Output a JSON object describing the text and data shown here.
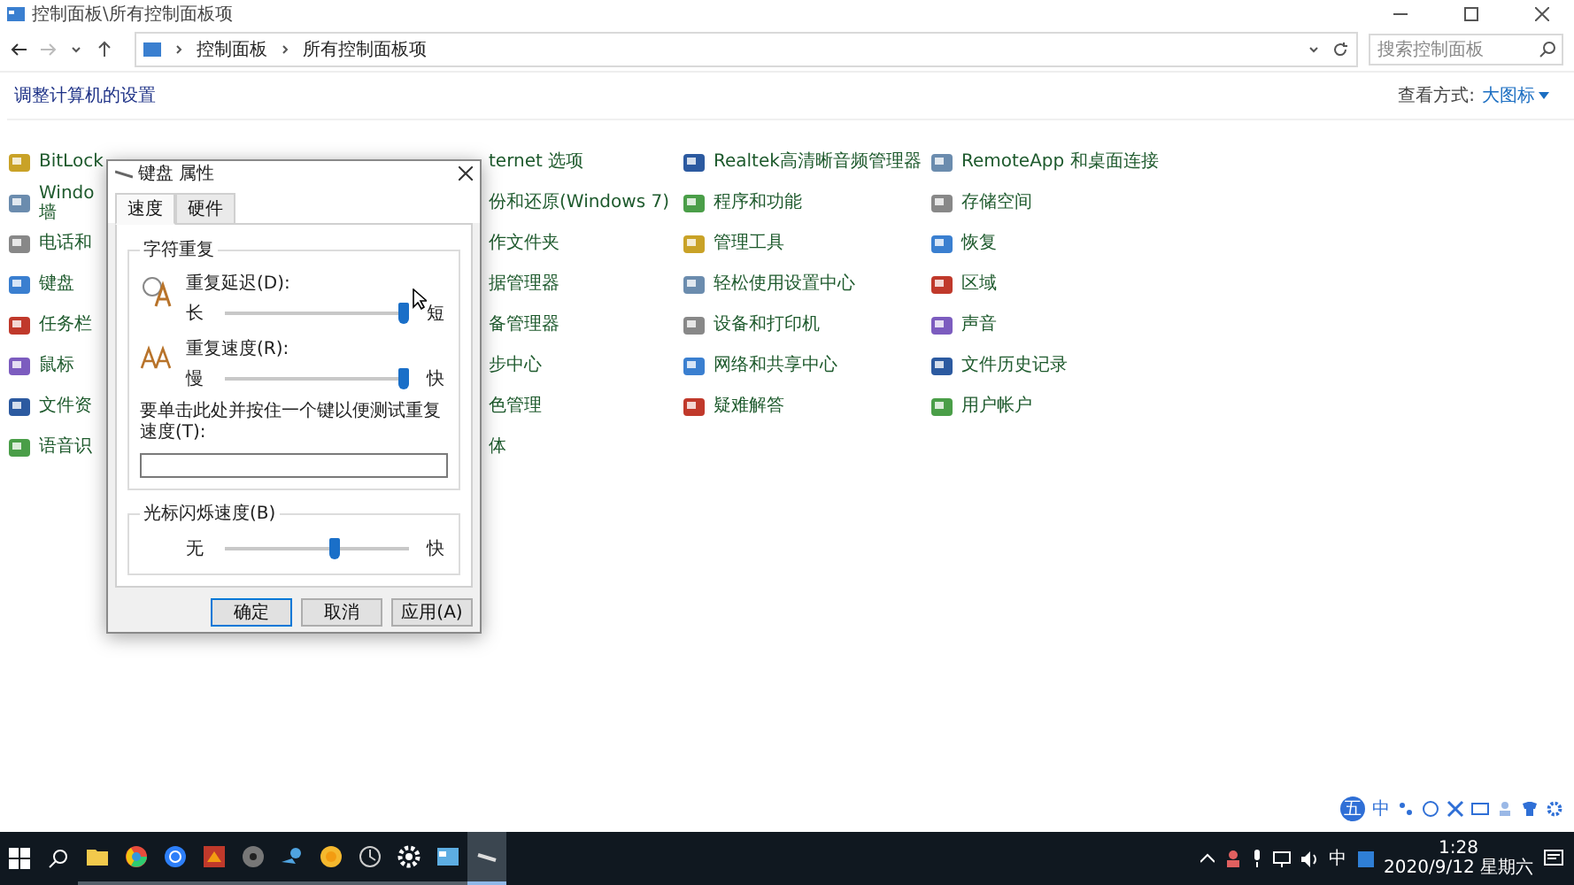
{
  "window": {
    "title": "控制面板\\所有控制面板项"
  },
  "address_bar": {
    "breadcrumb": [
      "控制面板",
      "所有控制面板项"
    ]
  },
  "search": {
    "placeholder": "搜索控制面板"
  },
  "heading": "调整计算机的设置",
  "view_by": {
    "label": "查看方式:",
    "value": "大图标"
  },
  "rows": [
    [
      "BitLock",
      "ternet 选项",
      "Realtek高清晰音频管理器",
      "RemoteApp 和桌面连接"
    ],
    [
      "Windo\n墙",
      "份和还原(Windows 7)",
      "程序和功能",
      "存储空间"
    ],
    [
      "电话和",
      "作文件夹",
      "管理工具",
      "恢复"
    ],
    [
      "键盘",
      "据管理器",
      "轻松使用设置中心",
      "区域"
    ],
    [
      "任务栏",
      "备管理器",
      "设备和打印机",
      "声音"
    ],
    [
      "鼠标",
      "步中心",
      "网络和共享中心",
      "文件历史记录"
    ],
    [
      "文件资",
      "色管理",
      "疑难解答",
      "用户帐户"
    ],
    [
      "语音识",
      "体"
    ]
  ],
  "dialog": {
    "title": "键盘 属性",
    "tabs": [
      {
        "label": "速度",
        "selected": true
      },
      {
        "label": "硬件",
        "selected": false
      }
    ],
    "groups": [
      {
        "title": "字符重复",
        "sliders": [
          {
            "kind": "delay",
            "label": "重复延迟(D):",
            "min_label": "长",
            "max_label": "短",
            "level": 1
          },
          {
            "kind": "rate",
            "label": "重复速度(R):",
            "min_label": "慢",
            "max_label": "快",
            "level": 1
          }
        ],
        "test_field": {
          "label": "要单击此处并按住一个键以便测试重复速度(T):"
        }
      },
      {
        "title": "光标闪烁速度(B)",
        "sliders": [
          {
            "kind": "blink",
            "min_label": "无",
            "max_label": "快",
            "level": 0.6
          }
        ]
      }
    ],
    "buttons": [
      {
        "label": "确定",
        "default": true
      },
      {
        "label": "取消",
        "default": false
      },
      {
        "label": "应用(A)",
        "default": false
      }
    ]
  },
  "ime_bar": {
    "logo": "五",
    "mode": "中"
  },
  "taskbar": {
    "apps": [
      {
        "kind": "folder",
        "selected": false
      },
      {
        "kind": "wheel",
        "selected": false
      },
      {
        "kind": "globe",
        "selected": false
      },
      {
        "kind": "game",
        "selected": false
      },
      {
        "kind": "disc",
        "selected": false
      },
      {
        "kind": "cloud",
        "selected": false
      },
      {
        "kind": "sun",
        "selected": false
      },
      {
        "kind": "clock",
        "selected": false
      },
      {
        "kind": "gear",
        "selected": false
      },
      {
        "kind": "window",
        "selected": false
      },
      {
        "kind": "keyboard",
        "selected": true
      }
    ],
    "ime": "中",
    "time": "1:28",
    "date": "2020/9/12 星期六"
  }
}
